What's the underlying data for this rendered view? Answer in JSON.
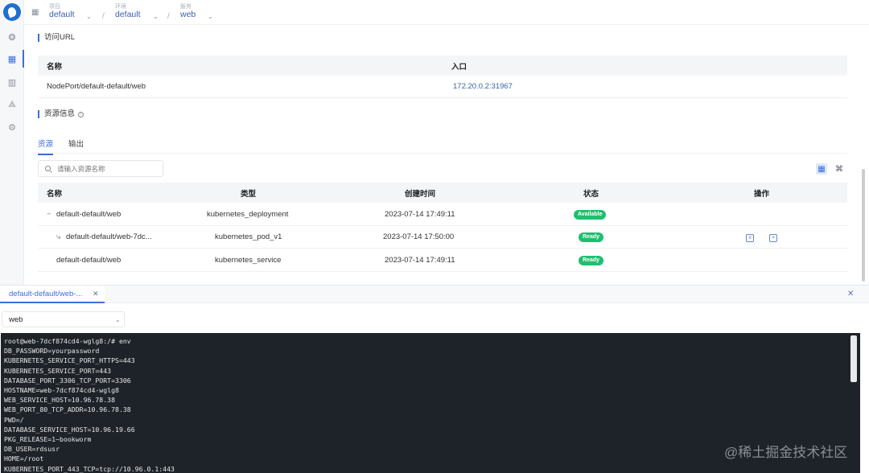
{
  "rail": {
    "icons": [
      "brain-icon",
      "apps-icon",
      "chart-icon",
      "topology-icon",
      "gear-icon"
    ]
  },
  "breadcrumb": {
    "project": {
      "caption": "项目",
      "value": "default"
    },
    "environment": {
      "caption": "环境",
      "value": "default"
    },
    "service": {
      "caption": "服务",
      "value": "web"
    }
  },
  "access_url": {
    "title": "访问URL",
    "headers": {
      "name": "名称",
      "entry": "入口"
    },
    "rows": [
      {
        "name": "NodePort/default-default/web",
        "entry": "172.20.0.2:31967"
      }
    ]
  },
  "resources": {
    "title": "资源信息",
    "tabs": [
      "资源",
      "输出"
    ],
    "search_placeholder": "请输入资源名称",
    "headers": {
      "name": "名称",
      "type": "类型",
      "created": "创建时间",
      "status": "状态",
      "actions": "操作"
    },
    "rows": [
      {
        "prefix": "−",
        "name": "default-default/web",
        "type": "kubernetes_deployment",
        "created": "2023-07-14 17:49:11",
        "status": "Available"
      },
      {
        "prefix": "⤷",
        "name": "default-default/web-7dc...",
        "type": "kubernetes_pod_v1",
        "created": "2023-07-14 17:50:00",
        "status": "Ready"
      },
      {
        "prefix": "",
        "name": "default-default/web",
        "type": "kubernetes_service",
        "created": "2023-07-14 17:49:11",
        "status": "Ready"
      }
    ]
  },
  "panel": {
    "tab_label": "default-default/web-...",
    "container_select": "web",
    "terminal_lines": [
      "root@web-7dcf874cd4-wglg8:/# env",
      "DB_PASSWORD=yourpassword",
      "KUBERNETES_SERVICE_PORT_HTTPS=443",
      "KUBERNETES_SERVICE_PORT=443",
      "DATABASE_PORT_3306_TCP_PORT=3306",
      "HOSTNAME=web-7dcf874cd4-wglg8",
      "WEB_SERVICE_HOST=10.96.78.38",
      "WEB_PORT_80_TCP_ADDR=10.96.78.38",
      "PWD=/",
      "DATABASE_SERVICE_HOST=10.96.19.66",
      "PKG_RELEASE=1~bookworm",
      "DB_USER=rdsusr",
      "HOME=/root",
      "KUBERNETES_PORT_443_TCP=tcp://10.96.0.1:443"
    ]
  },
  "watermark": "@稀土掘金技术社区",
  "colors": {
    "accent": "#3a6fd8",
    "status_green": "#1fbf6f",
    "terminal_bg": "#1e2329"
  }
}
